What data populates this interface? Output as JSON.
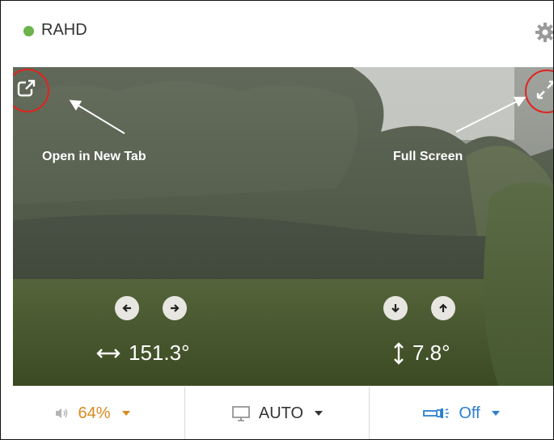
{
  "header": {
    "camera_name": "RAHD",
    "status_color": "#6bb34a"
  },
  "view": {
    "annotations": {
      "open_new_tab": "Open in New Tab",
      "full_screen": "Full Screen"
    },
    "pan": {
      "value": "151.3°"
    },
    "tilt": {
      "value": "7.8°"
    }
  },
  "controls": {
    "volume": {
      "value": "64%",
      "color": "#d98a1f",
      "icon": "speaker-icon"
    },
    "display": {
      "value": "AUTO",
      "color": "#333333",
      "icon": "monitor-icon"
    },
    "light": {
      "value": "Off",
      "color": "#2a7fd4",
      "icon": "floodlight-icon"
    }
  }
}
